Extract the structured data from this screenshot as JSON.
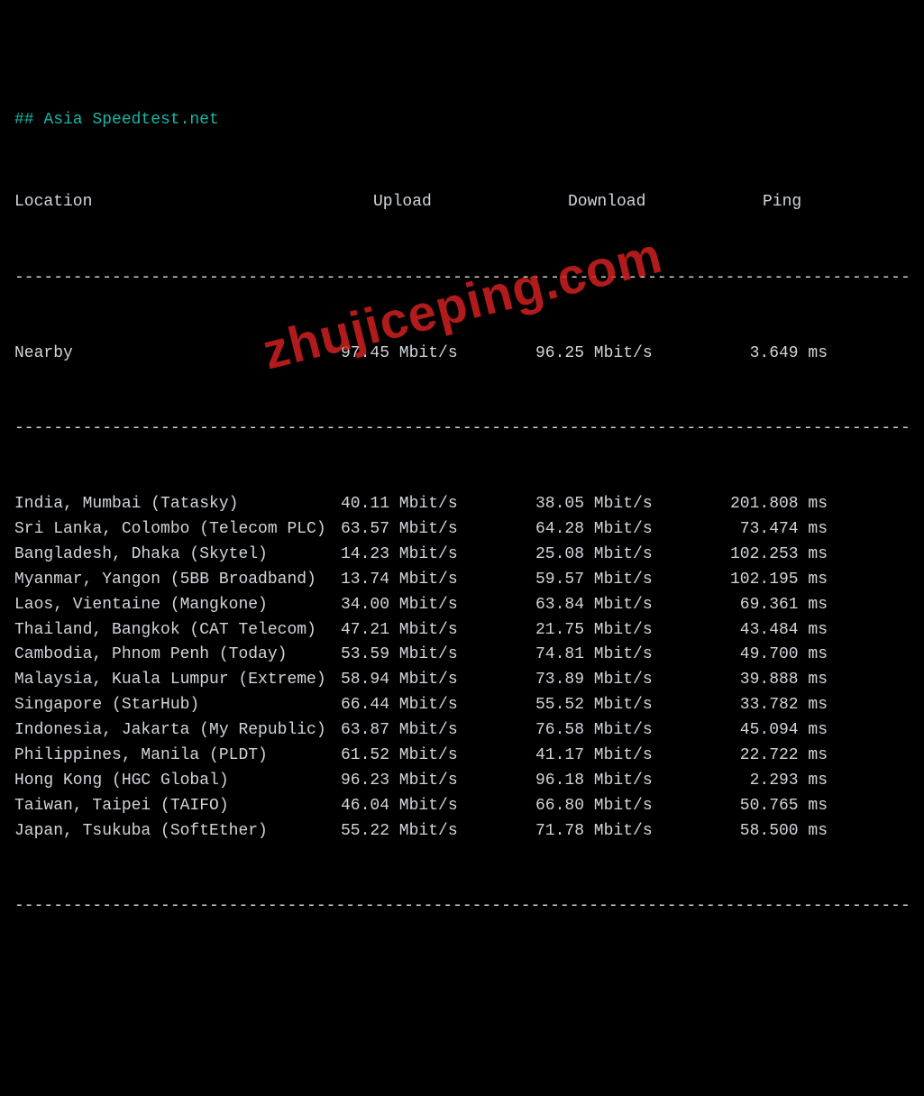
{
  "title": "## Asia Speedtest.net",
  "headers": {
    "location": "Location",
    "upload": "Upload",
    "download": "Download",
    "ping": "Ping"
  },
  "divider": "----------------------------------------------------------------------------------------------",
  "unit_speed": " Mbit/s",
  "unit_ping": " ms",
  "nearby": {
    "location": "Nearby",
    "upload": "97.45",
    "download": "96.25",
    "ping": "3.649"
  },
  "rows": [
    {
      "location": "India, Mumbai (Tatasky)",
      "upload": "40.11",
      "download": "38.05",
      "ping": "201.808"
    },
    {
      "location": "Sri Lanka, Colombo (Telecom PLC)",
      "upload": "63.57",
      "download": "64.28",
      "ping": "73.474"
    },
    {
      "location": "Bangladesh, Dhaka (Skytel)",
      "upload": "14.23",
      "download": "25.08",
      "ping": "102.253"
    },
    {
      "location": "Myanmar, Yangon (5BB Broadband)",
      "upload": "13.74",
      "download": "59.57",
      "ping": "102.195"
    },
    {
      "location": "Laos, Vientaine (Mangkone)",
      "upload": "34.00",
      "download": "63.84",
      "ping": "69.361"
    },
    {
      "location": "Thailand, Bangkok (CAT Telecom)",
      "upload": "47.21",
      "download": "21.75",
      "ping": "43.484"
    },
    {
      "location": "Cambodia, Phnom Penh (Today)",
      "upload": "53.59",
      "download": "74.81",
      "ping": "49.700"
    },
    {
      "location": "Malaysia, Kuala Lumpur (Extreme)",
      "upload": "58.94",
      "download": "73.89",
      "ping": "39.888"
    },
    {
      "location": "Singapore (StarHub)",
      "upload": "66.44",
      "download": "55.52",
      "ping": "33.782"
    },
    {
      "location": "Indonesia, Jakarta (My Republic)",
      "upload": "63.87",
      "download": "76.58",
      "ping": "45.094"
    },
    {
      "location": "Philippines, Manila (PLDT)",
      "upload": "61.52",
      "download": "41.17",
      "ping": "22.722"
    },
    {
      "location": "Hong Kong (HGC Global)",
      "upload": "96.23",
      "download": "96.18",
      "ping": "2.293"
    },
    {
      "location": "Taiwan, Taipei (TAIFO)",
      "upload": "46.04",
      "download": "66.80",
      "ping": "50.765"
    },
    {
      "location": "Japan, Tsukuba (SoftEther)",
      "upload": "55.22",
      "download": "71.78",
      "ping": "58.500"
    }
  ],
  "watermark": "zhujiceping.com",
  "chart_data": {
    "type": "table",
    "title": "Asia Speedtest.net",
    "columns": [
      "Location",
      "Upload (Mbit/s)",
      "Download (Mbit/s)",
      "Ping (ms)"
    ],
    "rows": [
      [
        "Nearby",
        97.45,
        96.25,
        3.649
      ],
      [
        "India, Mumbai (Tatasky)",
        40.11,
        38.05,
        201.808
      ],
      [
        "Sri Lanka, Colombo (Telecom PLC)",
        63.57,
        64.28,
        73.474
      ],
      [
        "Bangladesh, Dhaka (Skytel)",
        14.23,
        25.08,
        102.253
      ],
      [
        "Myanmar, Yangon (5BB Broadband)",
        13.74,
        59.57,
        102.195
      ],
      [
        "Laos, Vientaine (Mangkone)",
        34.0,
        63.84,
        69.361
      ],
      [
        "Thailand, Bangkok (CAT Telecom)",
        47.21,
        21.75,
        43.484
      ],
      [
        "Cambodia, Phnom Penh (Today)",
        53.59,
        74.81,
        49.7
      ],
      [
        "Malaysia, Kuala Lumpur (Extreme)",
        58.94,
        73.89,
        39.888
      ],
      [
        "Singapore (StarHub)",
        66.44,
        55.52,
        33.782
      ],
      [
        "Indonesia, Jakarta (My Republic)",
        63.87,
        76.58,
        45.094
      ],
      [
        "Philippines, Manila (PLDT)",
        61.52,
        41.17,
        22.722
      ],
      [
        "Hong Kong (HGC Global)",
        96.23,
        96.18,
        2.293
      ],
      [
        "Taiwan, Taipei (TAIFO)",
        46.04,
        66.8,
        50.765
      ],
      [
        "Japan, Tsukuba (SoftEther)",
        55.22,
        71.78,
        58.5
      ]
    ]
  }
}
